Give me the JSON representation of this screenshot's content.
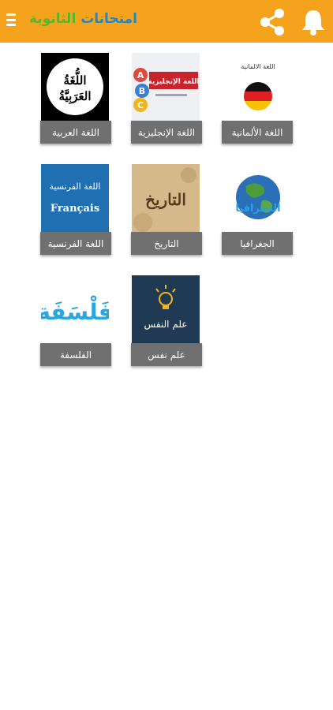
{
  "appbar": {
    "title_part1": "امتحانات",
    "title_part2": "الثانوية",
    "menu_icon": "menu-icon",
    "share_icon": "share-icon",
    "bell_icon": "bell-icon",
    "background": "#f5a31c"
  },
  "subjects": [
    {
      "label": "اللغة العربية",
      "thumb_text": [
        "اللُّغَةُ",
        "العَرَبِيَّةُ"
      ]
    },
    {
      "label": "اللغة الإنجليزية",
      "thumb_text": [
        "اللغة الإنجليزية",
        "A",
        "B",
        "C"
      ]
    },
    {
      "label": "اللغة الألمانية",
      "thumb_text": [
        "اللغة الالمانية"
      ]
    },
    {
      "label": "اللغة الفرنسية",
      "thumb_text": [
        "اللغة الفرنسية",
        "Français"
      ]
    },
    {
      "label": "التاريخ",
      "thumb_text": [
        "التاريخ"
      ]
    },
    {
      "label": "الجغرافيا",
      "thumb_text": [
        "الجغرافيا"
      ]
    },
    {
      "label": "الفلسفة",
      "thumb_text": [
        "فَلْسَفَة"
      ]
    },
    {
      "label": "علم نفس",
      "thumb_text": [
        "علم النفس"
      ]
    }
  ],
  "colors": {
    "label_bg": "#707070",
    "title_blue": "#1e88c8",
    "title_green": "#5ab52a"
  }
}
